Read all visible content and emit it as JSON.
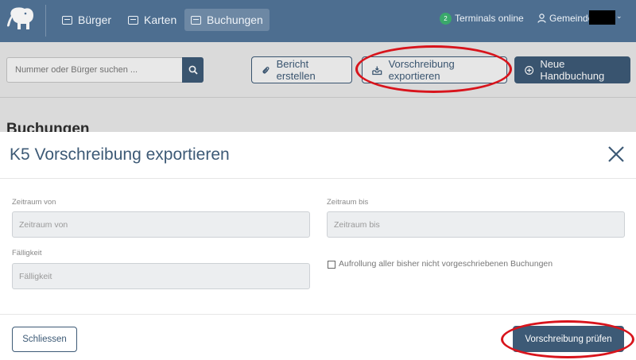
{
  "nav": {
    "items": [
      {
        "label": "Bürger",
        "icon": "id-card-icon"
      },
      {
        "label": "Karten",
        "icon": "card-icon"
      },
      {
        "label": "Buchungen",
        "icon": "inbox-icon"
      }
    ],
    "terminals_count": "2",
    "terminals_label": "Terminals online",
    "user_label": "Gemeinde",
    "user_caret": "⌄"
  },
  "toolbar": {
    "search_placeholder": "Nummer oder Bürger suchen ...",
    "report_label": "Bericht erstellen",
    "export_label": "Vorschreibung exportieren",
    "new_booking_label": "Neue Handbuchung"
  },
  "page": {
    "heading": "Buchungen"
  },
  "modal": {
    "title": "K5 Vorschreibung exportieren",
    "from_label": "Zeitraum von",
    "from_placeholder": "Zeitraum von",
    "to_label": "Zeitraum bis",
    "to_placeholder": "Zeitraum bis",
    "due_label": "Fälligkeit",
    "due_placeholder": "Fälligkeit",
    "rollup_label": "Aufrollung aller bisher nicht vorgeschriebenen Buchungen",
    "close_label": "Schliessen",
    "check_label": "Vorschreibung prüfen"
  },
  "colors": {
    "nav_bg": "#4d6e90",
    "primary": "#3d5a76",
    "annotation": "#d8141c",
    "online": "#3aa86b"
  }
}
